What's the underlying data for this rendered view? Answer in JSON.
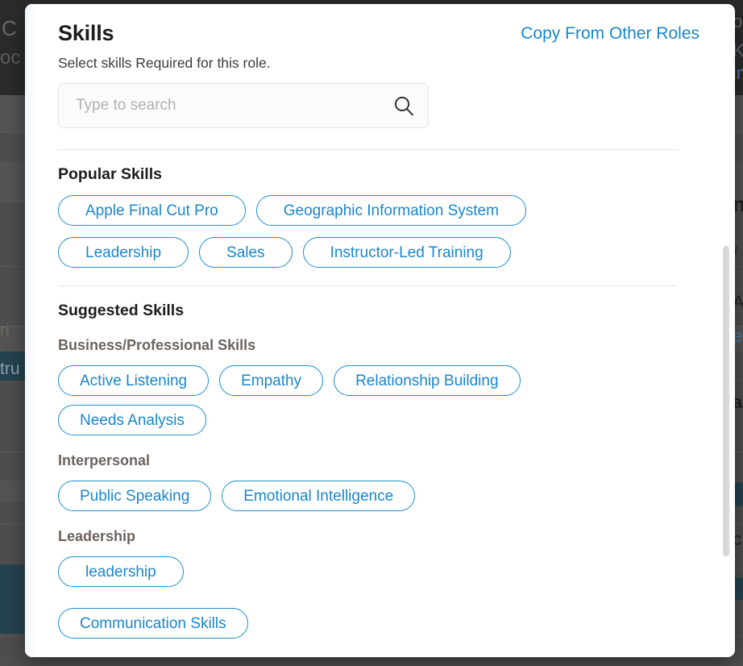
{
  "modal": {
    "title": "Skills",
    "copy_link_label": "Copy From Other Roles",
    "subtitle": "Select skills Required for this role.",
    "search": {
      "placeholder": "Type to search",
      "value": "",
      "icon": "search-icon"
    },
    "popular": {
      "heading": "Popular Skills",
      "chips": [
        "Apple Final Cut Pro",
        "Geographic Information System",
        "Leadership",
        "Sales",
        "Instructor-Led Training"
      ]
    },
    "suggested": {
      "heading": "Suggested Skills",
      "groups": [
        {
          "label": "Business/Professional Skills",
          "chips": [
            "Active Listening",
            "Empathy",
            "Relationship Building",
            "Needs Analysis"
          ]
        },
        {
          "label": "Interpersonal",
          "chips": [
            "Public Speaking",
            "Emotional Intelligence"
          ]
        },
        {
          "label": "Leadership",
          "chips": [
            "leadership"
          ]
        }
      ],
      "extra_chips": [
        "Communication Skills"
      ]
    }
  },
  "colors": {
    "accent_blue": "#1a86cd",
    "chip_border": "#1d8fd2",
    "group_label": "#6c635e",
    "divider": "#e4e4e4",
    "modal_bg": "#ffffff",
    "backdrop": "#4e4e4e",
    "scrollbar_thumb": "#d8d8d8"
  },
  "backdrop": {
    "top_left_text": "C",
    "top_left_text2": "oc",
    "left_texts": [
      "ri",
      "tru"
    ],
    "right_texts": [
      "o",
      "K",
      "in",
      "n",
      "/",
      "A",
      "e",
      "a",
      "c"
    ]
  }
}
